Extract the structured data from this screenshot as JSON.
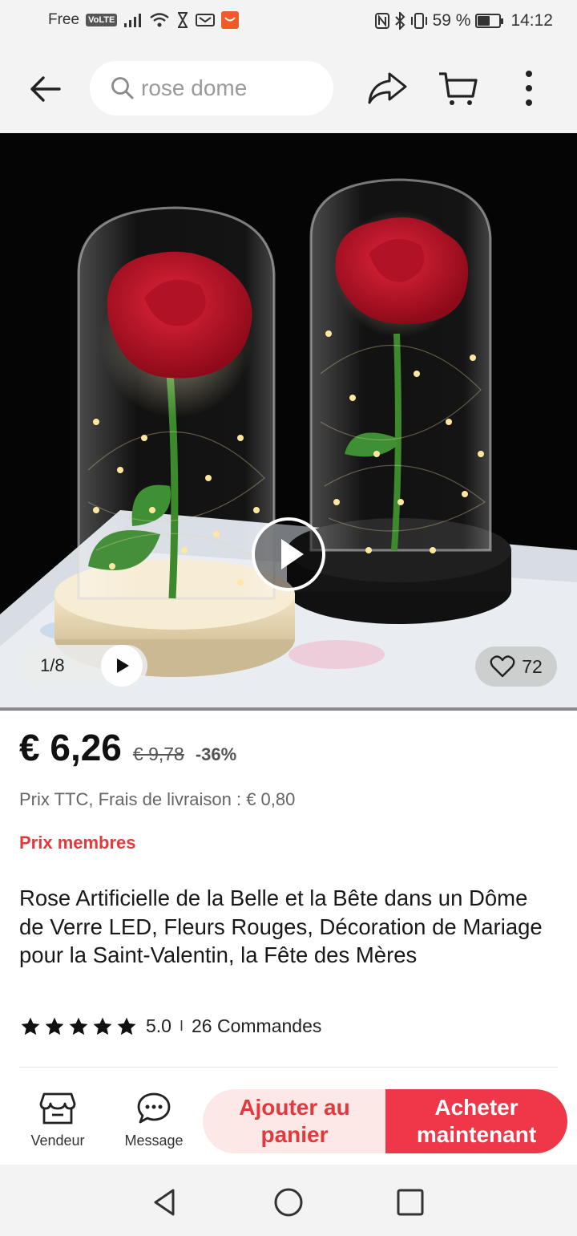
{
  "status_bar": {
    "carrier": "Free",
    "network_badge": "VoLTE",
    "battery": "59 %",
    "battery_level": 0.59,
    "time": "14:12",
    "icons": [
      "signal-icon",
      "wifi-icon",
      "hourglass-icon",
      "notification-icon",
      "app-notification-icon",
      "nfc-icon",
      "bluetooth-icon",
      "vibrate-icon",
      "battery-icon"
    ]
  },
  "header": {
    "search_placeholder": "rose dome",
    "icons": [
      "back-arrow-icon",
      "search-icon",
      "share-icon",
      "cart-icon",
      "more-vertical-icon"
    ]
  },
  "gallery": {
    "counter": "1/8",
    "wishlist_count": "72",
    "colors": {
      "background": "#050505",
      "rose": "#c8102e",
      "light": "#ffe9a8"
    }
  },
  "product": {
    "price": "€ 6,26",
    "original_price": "€ 9,78",
    "discount": "-36%",
    "shipping": "Prix TTC, Frais de livraison : € 0,80",
    "member_label": "Prix membres",
    "title": "Rose Artificielle de la Belle et la Bête dans un Dôme de Verre LED, Fleurs Rouges, Décoration de Mariage pour la Saint-Valentin, la Fête des Mères",
    "rating": "5.0",
    "rating_stars": 5,
    "separator": "I",
    "orders": "26 Commandes"
  },
  "actions": {
    "seller_label": "Vendeur",
    "message_label": "Message",
    "add_to_cart_label": "Ajouter au panier",
    "buy_now_label": "Acheter maintenant"
  },
  "colors": {
    "accent": "#e4393c",
    "buy_button": "#f03747",
    "cart_button_bg": "#fde8e8",
    "chrome_bg": "#f3f3f3"
  }
}
